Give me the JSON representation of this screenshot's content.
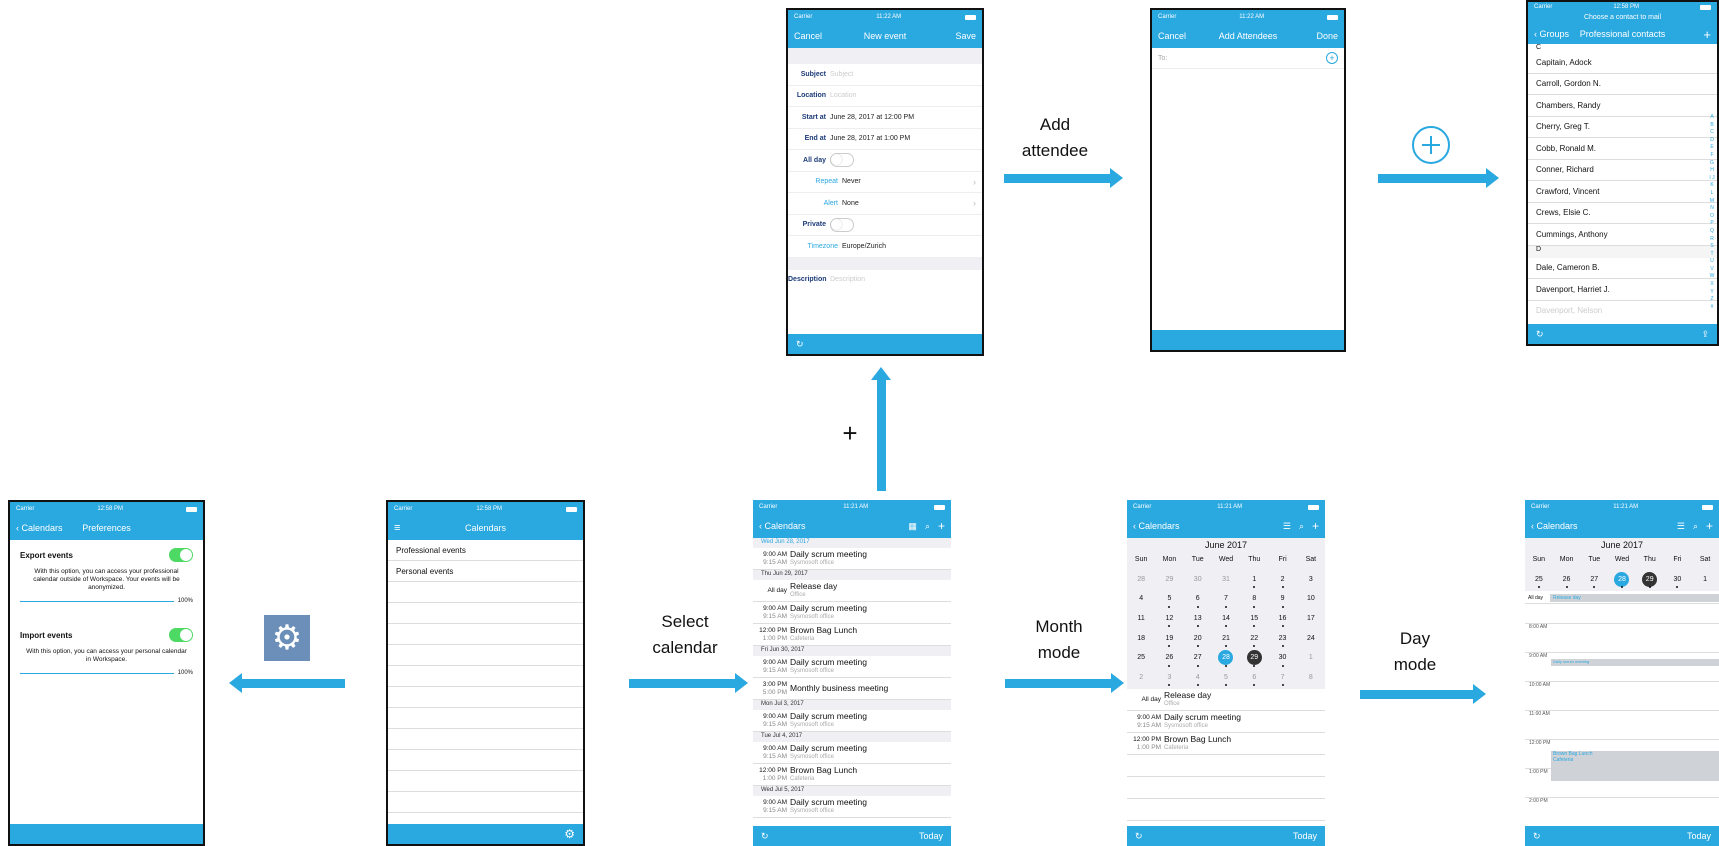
{
  "colors": {
    "accent": "#2aa8e0",
    "toggle_on": "#4cd964",
    "dark": "#333333"
  },
  "status": {
    "carrier": "Carrier",
    "t1": "11:22 AM",
    "t2": "11:22 AM",
    "t3": "12:58 PM",
    "t4": "12:58 PM",
    "t5": "12:58 PM",
    "t6": "11:21 AM",
    "t7": "11:21 AM",
    "t8": "11:21 AM"
  },
  "labels": {
    "add_attendee_1": "Add",
    "add_attendee_2": "attendee",
    "plus": "+",
    "select_cal_1": "Select",
    "select_cal_2": "calendar",
    "month_1": "Month",
    "month_2": "mode",
    "day_1": "Day",
    "day_2": "mode"
  },
  "new_event": {
    "cancel": "Cancel",
    "title": "New event",
    "save": "Save",
    "rows": [
      {
        "k": "Subject",
        "v": "Subject",
        "ph": true
      },
      {
        "k": "Location",
        "v": "Location",
        "ph": true
      },
      {
        "k": "Start at",
        "v": "June 28, 2017 at 12:00 PM"
      },
      {
        "k": "End at",
        "v": "June 28, 2017 at 1:00 PM"
      }
    ],
    "all_day": "All day",
    "repeat_k": "Repeat",
    "repeat_v": "Never",
    "alert_k": "Alert",
    "alert_v": "None",
    "private": "Private",
    "timezone_k": "Timezone",
    "timezone_v": "Europe/Zurich",
    "description_k": "Description",
    "description_v": "Description"
  },
  "attendees": {
    "cancel": "Cancel",
    "title": "Add Attendees",
    "done": "Done",
    "to": "To:"
  },
  "contacts": {
    "prompt": "Choose a contact to mail",
    "back": "Groups",
    "title": "Professional contacts",
    "sec_c": "C",
    "items_c": [
      "Capitain, Adock",
      "Carroll, Gordon N.",
      "Chambers, Randy",
      "Cherry, Greg T.",
      "Cobb, Ronald M.",
      "Conner, Richard",
      "Crawford, Vincent",
      "Crews, Elsie C.",
      "Cummings, Anthony"
    ],
    "sec_d": "D",
    "items_d": [
      "Dale, Cameron B.",
      "Davenport, Harriet J."
    ],
    "faded": "Davenport, Nelson",
    "index": "A B C D E F G H I J K L M N O P Q R S T U V W X Y Z #"
  },
  "prefs": {
    "back": "Calendars",
    "title": "Preferences",
    "export_title": "Export events",
    "export_desc": "With this option, you can access your professional calendar outside of Workspace. Your events will be anonymized.",
    "export_pct": "100%",
    "import_title": "Import events",
    "import_desc": "With this option, you can access your personal calendar in Workspace.",
    "import_pct": "100%"
  },
  "calendars": {
    "title": "Calendars",
    "items": [
      "Professional events",
      "Personal events"
    ]
  },
  "list": {
    "back": "Calendars",
    "today": "Today",
    "groups": [
      {
        "h": "Wed Jun 28, 2017",
        "ev": [
          {
            "s": "9:00 AM",
            "e": "9:15 AM",
            "n": "Daily scrum meeting",
            "l": "Sysmosoft office"
          }
        ]
      },
      {
        "h": "Thu Jun 29, 2017",
        "ev": [
          {
            "s": "All day",
            "e": "",
            "n": "Release day",
            "l": "Office"
          },
          {
            "s": "9:00 AM",
            "e": "9:15 AM",
            "n": "Daily scrum meeting",
            "l": "Sysmosoft office"
          },
          {
            "s": "12:00 PM",
            "e": "1:00 PM",
            "n": "Brown Bag Lunch",
            "l": "Cafeteria"
          }
        ]
      },
      {
        "h": "Fri Jun 30, 2017",
        "ev": [
          {
            "s": "9:00 AM",
            "e": "9:15 AM",
            "n": "Daily scrum meeting",
            "l": "Sysmosoft office"
          },
          {
            "s": "3:00 PM",
            "e": "5:00 PM",
            "n": "Monthly business meeting",
            "l": ""
          }
        ]
      },
      {
        "h": "Mon Jul 3, 2017",
        "ev": [
          {
            "s": "9:00 AM",
            "e": "9:15 AM",
            "n": "Daily scrum meeting",
            "l": "Sysmosoft office"
          }
        ]
      },
      {
        "h": "Tue Jul 4, 2017",
        "ev": [
          {
            "s": "9:00 AM",
            "e": "9:15 AM",
            "n": "Daily scrum meeting",
            "l": "Sysmosoft office"
          },
          {
            "s": "12:00 PM",
            "e": "1:00 PM",
            "n": "Brown Bag Lunch",
            "l": "Cafeteria"
          }
        ]
      },
      {
        "h": "Wed Jul 5, 2017",
        "ev": [
          {
            "s": "9:00 AM",
            "e": "9:15 AM",
            "n": "Daily scrum meeting",
            "l": "Sysmosoft office"
          }
        ]
      }
    ]
  },
  "month": {
    "back": "Calendars",
    "today": "Today",
    "title": "June 2017",
    "dow": [
      "Sun",
      "Mon",
      "Tue",
      "Wed",
      "Thu",
      "Fri",
      "Sat"
    ],
    "weeks": [
      [
        "28",
        "29",
        "30",
        "31",
        "1",
        "2",
        "3"
      ],
      [
        "4",
        "5",
        "6",
        "7",
        "8",
        "9",
        "10"
      ],
      [
        "11",
        "12",
        "13",
        "14",
        "15",
        "16",
        "17"
      ],
      [
        "18",
        "19",
        "20",
        "21",
        "22",
        "23",
        "24"
      ],
      [
        "25",
        "26",
        "27",
        "28",
        "29",
        "30",
        "1"
      ],
      [
        "2",
        "3",
        "4",
        "5",
        "6",
        "7",
        "8"
      ]
    ],
    "events": [
      {
        "s": "All day",
        "e": "",
        "n": "Release day",
        "l": "Office"
      },
      {
        "s": "9:00 AM",
        "e": "9:15 AM",
        "n": "Daily scrum meeting",
        "l": "Sysmosoft office"
      },
      {
        "s": "12:00 PM",
        "e": "1:00 PM",
        "n": "Brown Bag Lunch",
        "l": "Cafeteria"
      }
    ]
  },
  "day": {
    "back": "Calendars",
    "today": "Today",
    "title": "June 2017",
    "dow": [
      "Sun",
      "Mon",
      "Tue",
      "Wed",
      "Thu",
      "Fri",
      "Sat"
    ],
    "week": [
      "25",
      "26",
      "27",
      "28",
      "29",
      "30",
      "1"
    ],
    "all_day": "All day",
    "release": "Release day",
    "hours": [
      "8:00 AM",
      "9:00 AM",
      "10:00 AM",
      "11:00 AM",
      "12:00 PM",
      "1:00 PM",
      "2:00 PM"
    ],
    "scrum": "Daily scrum meeting",
    "lunch": "Brown Bag Lunch",
    "lunch_loc": "Cafeteria"
  }
}
